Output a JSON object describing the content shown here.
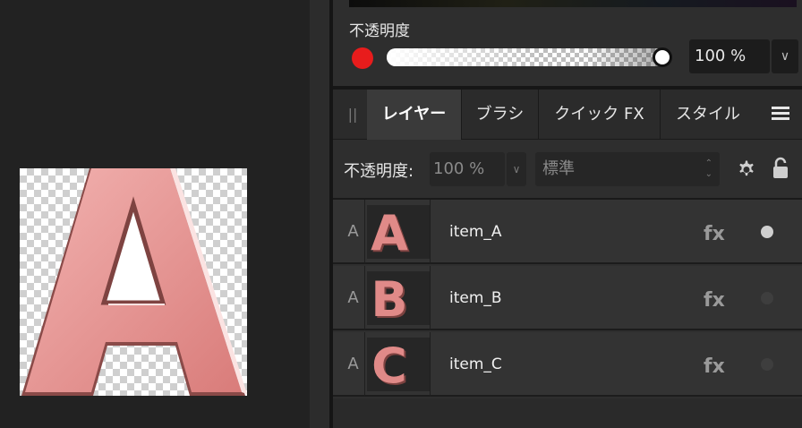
{
  "color_panel": {
    "opacity_title": "不透明度",
    "swatch_color": "#e81c1c",
    "opacity_value": "100 %",
    "opacity_level": 1.0,
    "dropdown_glyph": "∨"
  },
  "tabs": {
    "grip_glyph": "||",
    "items": [
      {
        "label": "レイヤー",
        "active": true
      },
      {
        "label": "ブラシ",
        "active": false
      },
      {
        "label": "クイック FX",
        "active": false
      },
      {
        "label": "スタイル",
        "active": false
      }
    ],
    "menu_icon": "hamburger-menu-icon"
  },
  "layer_controls": {
    "opacity_label": "不透明度:",
    "opacity_value": "100 %",
    "dropdown_glyph": "∨",
    "blend_mode": "標準",
    "settings_icon": "gear-icon",
    "lock_icon": "lock-icon"
  },
  "layers": [
    {
      "type_glyph": "A",
      "thumb_letter": "A",
      "name": "item_A",
      "fx_icon": "fx-icon",
      "visible": true
    },
    {
      "type_glyph": "A",
      "thumb_letter": "B",
      "name": "item_B",
      "fx_icon": "fx-icon",
      "visible": false
    },
    {
      "type_glyph": "A",
      "thumb_letter": "C",
      "name": "item_C",
      "fx_icon": "fx-icon",
      "visible": false
    }
  ],
  "canvas": {
    "letter": "A",
    "letter_color": "#e08a88"
  }
}
